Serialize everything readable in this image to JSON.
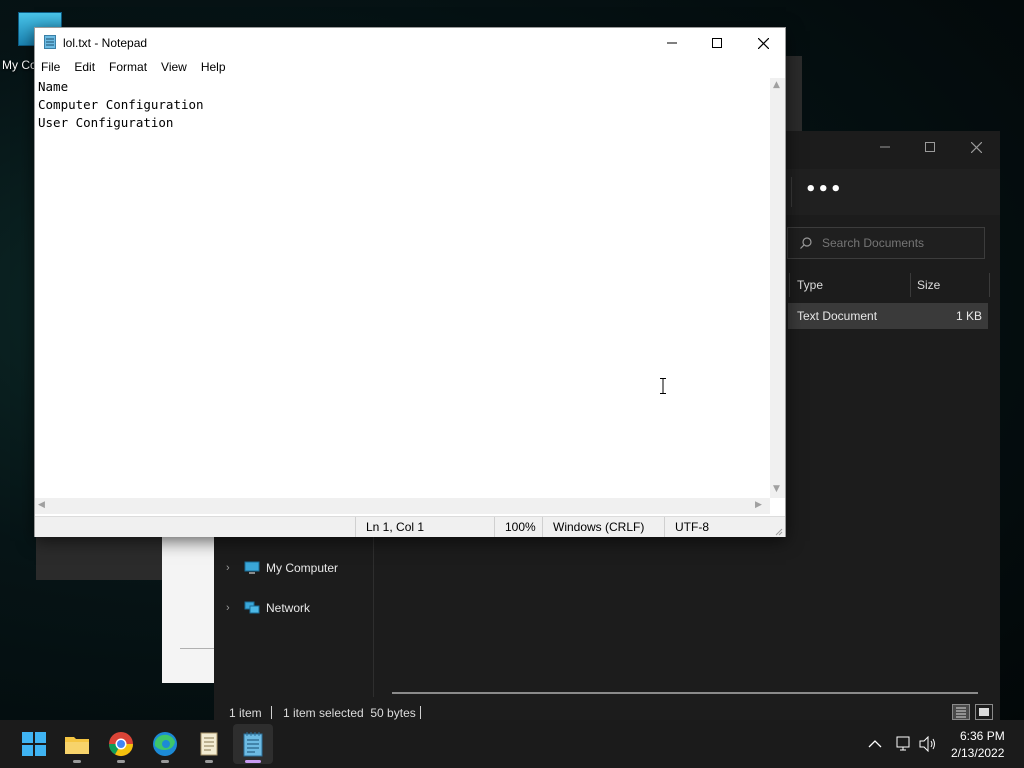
{
  "desktop": {
    "icon_label": "My Co"
  },
  "notepad": {
    "title": "lol.txt - Notepad",
    "menu": [
      "File",
      "Edit",
      "Format",
      "View",
      "Help"
    ],
    "lines": [
      "Name",
      "Computer Configuration",
      "User Configuration"
    ],
    "status": {
      "position": "Ln 1, Col 1",
      "zoom": "100%",
      "line_ending": "Windows (CRLF)",
      "encoding": "UTF-8"
    }
  },
  "explorer": {
    "more_label": "•••",
    "search_placeholder": "Search Documents",
    "columns": [
      "Type",
      "Size"
    ],
    "file": {
      "type": "Text Document",
      "size": "1 KB"
    },
    "nav": [
      "My Computer",
      "Network"
    ],
    "status": {
      "count": "1 item",
      "selected": "1 item selected  50 bytes"
    }
  },
  "clock": {
    "time": "6:36 PM",
    "date": "2/13/2022"
  },
  "colors": {
    "accent": "#0078d4",
    "taskbar": "#1b1b1b",
    "explorer_bg": "#1c1c1c"
  }
}
